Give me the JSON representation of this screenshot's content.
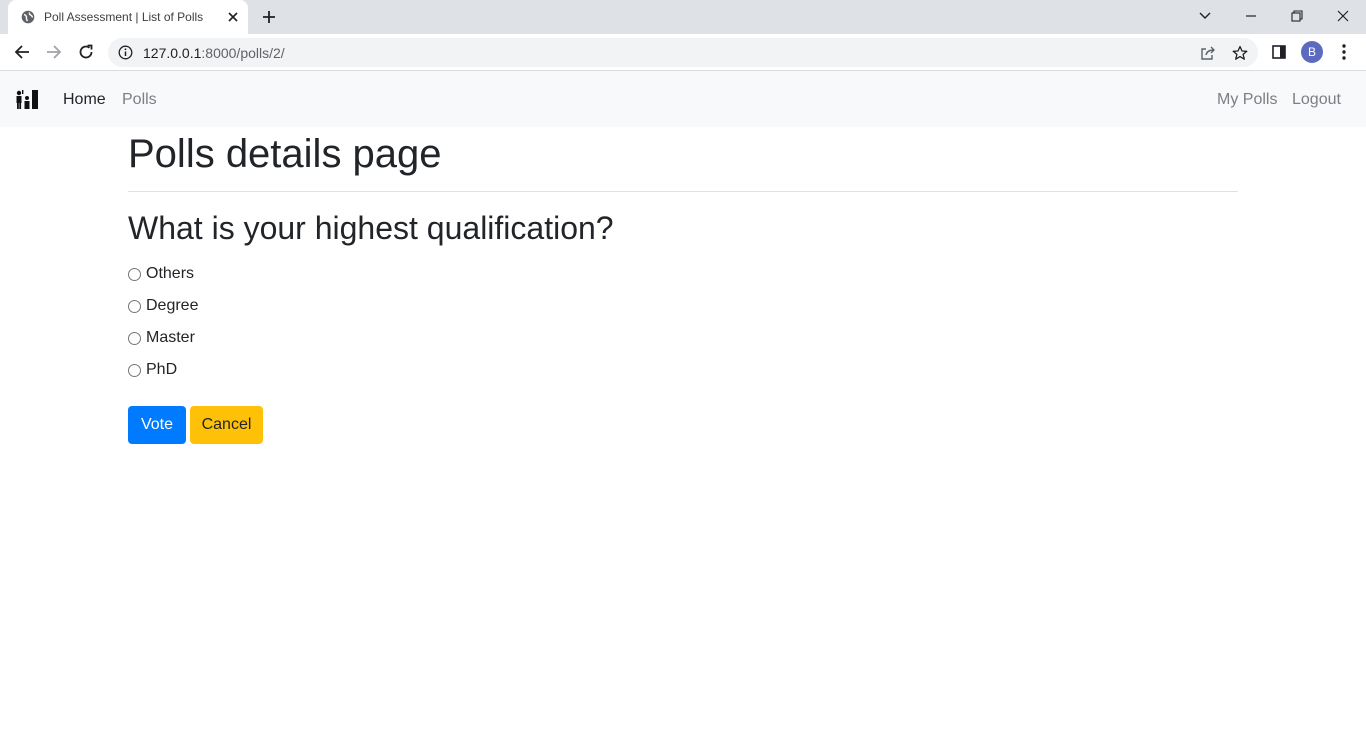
{
  "browser": {
    "tab_title": "Poll Assessment | List of Polls",
    "url_host": "127.0.0.1",
    "url_rest": ":8000/polls/2/",
    "profile_initial": "B",
    "icons": {
      "favicon": "globe-icon",
      "tab_close": "close-icon",
      "new_tab": "plus-icon",
      "back": "back-arrow-icon",
      "forward": "forward-arrow-icon",
      "reload": "reload-icon",
      "site_info": "info-icon",
      "share": "share-icon",
      "bookmark": "star-icon",
      "side_panel": "side-panel-icon",
      "menu": "kebab-menu-icon"
    }
  },
  "navbar": {
    "brand_icon": "people-podium-logo",
    "links": [
      {
        "label": "Home",
        "active": true
      },
      {
        "label": "Polls",
        "active": false
      }
    ],
    "right_links": [
      {
        "label": "My Polls"
      },
      {
        "label": "Logout"
      }
    ]
  },
  "main": {
    "page_title": "Polls details page",
    "question": "What is your highest qualification?",
    "choices": [
      {
        "label": "Others",
        "selected": false
      },
      {
        "label": "Degree",
        "selected": false
      },
      {
        "label": "Master",
        "selected": false
      },
      {
        "label": "PhD",
        "selected": false
      }
    ],
    "vote_label": "Vote",
    "cancel_label": "Cancel"
  },
  "colors": {
    "primary": "#007bff",
    "warning": "#ffc107",
    "navbar_bg": "#f8f9fa",
    "text": "#212529",
    "muted_link": "#7b7f84"
  }
}
